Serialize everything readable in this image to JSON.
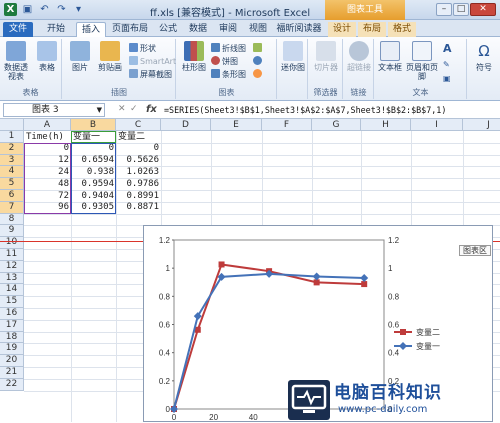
{
  "window": {
    "title": "ff.xls [兼容模式] - Microsoft Excel",
    "context_group": "图表工具",
    "buttons": [
      "–",
      "□",
      "✕"
    ]
  },
  "quick_access": [
    "save-icon",
    "undo-icon",
    "redo-icon",
    "customize-icon"
  ],
  "tabs": [
    "文件",
    "开始",
    "插入",
    "页面布局",
    "公式",
    "数据",
    "审阅",
    "视图",
    "福昕阅读器",
    "设计",
    "布局",
    "格式"
  ],
  "ribbon": {
    "groups": [
      {
        "label": "表格",
        "buttons": [
          "数据透视表",
          "表格"
        ]
      },
      {
        "label": "插图",
        "buttons": [
          "图片",
          "剪贴画",
          "形状",
          "SmartArt",
          "屏幕截图"
        ]
      },
      {
        "label": "图表",
        "buttons": [
          "柱形图",
          "折线图",
          "饼图",
          "条形图",
          "面积图",
          "散点图",
          "其他图表"
        ]
      },
      {
        "label": "",
        "buttons": [
          "迷你图"
        ]
      },
      {
        "label": "筛选器",
        "buttons": [
          "切片器"
        ]
      },
      {
        "label": "链接",
        "buttons": [
          "超链接"
        ]
      },
      {
        "label": "文本",
        "buttons": [
          "文本框",
          "页眉和页脚",
          "艺术字",
          "符号"
        ]
      }
    ],
    "right_labels": [
      "符号"
    ]
  },
  "formula_bar": {
    "name_box": "图表 3",
    "fx": "fx",
    "formula": "=SERIES(Sheet3!$B$1,Sheet3!$A$2:$A$7,Sheet3!$B$2:$B$7,1)"
  },
  "columns": [
    "A",
    "B",
    "C",
    "D",
    "E",
    "F",
    "G",
    "H",
    "I",
    "J"
  ],
  "rows": [
    "1",
    "2",
    "3",
    "4",
    "5",
    "6",
    "7",
    "8",
    "9",
    "10",
    "11",
    "12",
    "13",
    "14",
    "15",
    "16",
    "17",
    "18",
    "19",
    "20",
    "21",
    "22"
  ],
  "table": {
    "headers": [
      "Time(h)",
      "变量一",
      "变量二"
    ],
    "rows": [
      [
        "0",
        "0",
        "0"
      ],
      [
        "12",
        "0.6594",
        "0.5626"
      ],
      [
        "24",
        "0.938",
        "1.0263"
      ],
      [
        "48",
        "0.9594",
        "0.9786"
      ],
      [
        "72",
        "0.9404",
        "0.8991"
      ],
      [
        "96",
        "0.9305",
        "0.8871"
      ]
    ]
  },
  "chart_tooltip": "图表区",
  "chart_data": {
    "type": "line",
    "x": [
      0,
      12,
      24,
      48,
      72,
      96
    ],
    "series": [
      {
        "name": "变量二",
        "values": [
          0,
          0.5626,
          1.0263,
          0.9786,
          0.8991,
          0.8871
        ],
        "color": "#be3b3b",
        "marker": "square"
      },
      {
        "name": "变量一",
        "values": [
          0,
          0.6594,
          0.938,
          0.9594,
          0.9404,
          0.9305
        ],
        "color": "#4472b8",
        "marker": "diamond"
      }
    ],
    "ylim": [
      0,
      1.2
    ],
    "yticks": [
      "0",
      "0.2",
      "0.4",
      "0.6",
      "0.8",
      "1",
      "1.2"
    ],
    "xticks_visible": [
      "0",
      "20",
      "40",
      "60"
    ],
    "legend_position": "right",
    "colors": {
      "series1": "#be3b3b",
      "series2": "#4472b8"
    }
  },
  "watermark": {
    "title": "电脑百科知识",
    "url": "www.pc-daily.com"
  }
}
